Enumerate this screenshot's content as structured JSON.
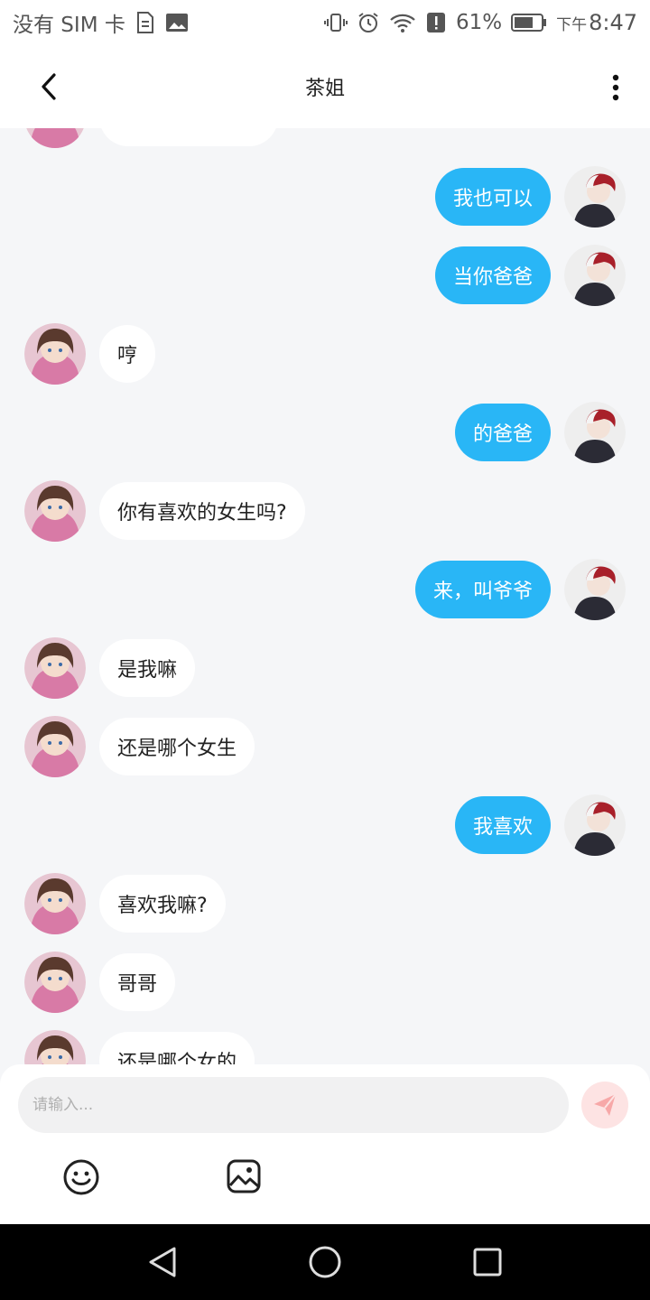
{
  "status_bar": {
    "carrier": "没有 SIM 卡",
    "battery": "61%",
    "ampm": "下午",
    "time": "8:47",
    "icons": [
      "file-icon",
      "image-icon",
      "vibrate-icon",
      "alarm-icon",
      "wifi-icon",
      "alert-icon",
      "battery-icon"
    ]
  },
  "header": {
    "title": "茶姐",
    "back_icon": "chevron-left-icon",
    "more_icon": "more-vertical-icon"
  },
  "messages": [
    {
      "from": "me",
      "text": "我也可以"
    },
    {
      "from": "me",
      "text": "当你爸爸"
    },
    {
      "from": "other",
      "text": "哼"
    },
    {
      "from": "me",
      "text": "的爸爸"
    },
    {
      "from": "other",
      "text": "你有喜欢的女生吗?"
    },
    {
      "from": "me",
      "text": "来，叫爷爷"
    },
    {
      "from": "other",
      "text": "是我嘛"
    },
    {
      "from": "other",
      "text": "还是哪个女生"
    },
    {
      "from": "me",
      "text": "我喜欢"
    },
    {
      "from": "other",
      "text": "喜欢我嘛?"
    },
    {
      "from": "other",
      "text": "哥哥"
    },
    {
      "from": "other",
      "text": "还是哪个女的"
    }
  ],
  "input": {
    "placeholder": "请输入...",
    "value": ""
  },
  "toolbar": {
    "send_icon": "send-icon",
    "emoji_icon": "emoji-icon",
    "image_icon": "image-icon"
  },
  "colors": {
    "sent_bubble": "#29b6f6",
    "received_bubble": "#ffffff",
    "chat_background": "#f5f6f8",
    "send_button_bg": "#fde3e3",
    "send_button_icon": "#f7a8a8"
  }
}
